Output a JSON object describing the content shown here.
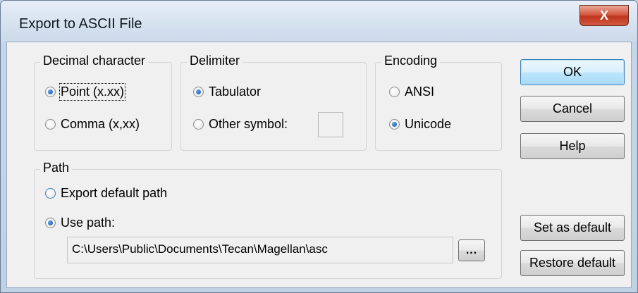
{
  "window": {
    "title": "Export to ASCII File",
    "close_glyph": "X"
  },
  "decimal": {
    "title": "Decimal character",
    "options": [
      {
        "label": "Point (x.xx)",
        "checked": true
      },
      {
        "label": "Comma (x,xx)",
        "checked": false
      }
    ]
  },
  "delimiter": {
    "title": "Delimiter",
    "options": [
      {
        "label": "Tabulator",
        "checked": true
      },
      {
        "label": "Other symbol:",
        "checked": false
      }
    ],
    "other_symbol_value": ""
  },
  "encoding": {
    "title": "Encoding",
    "options": [
      {
        "label": "ANSI",
        "checked": false
      },
      {
        "label": "Unicode",
        "checked": true
      }
    ]
  },
  "path": {
    "title": "Path",
    "options": [
      {
        "label": "Export default path",
        "checked": false
      },
      {
        "label": "Use path:",
        "checked": true
      }
    ],
    "value": "C:\\Users\\Public\\Documents\\Tecan\\Magellan\\asc",
    "browse_label": "..."
  },
  "buttons": {
    "ok": "OK",
    "cancel": "Cancel",
    "help": "Help",
    "set_default": "Set as default",
    "restore_default": "Restore default"
  }
}
